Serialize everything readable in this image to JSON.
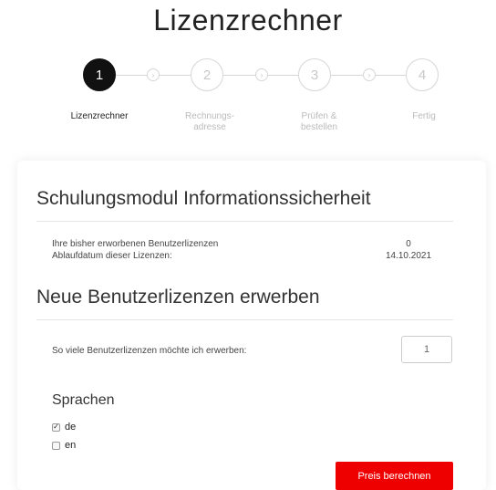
{
  "page_title": "Lizenzrechner",
  "steps": [
    {
      "number": "1",
      "label": "Lizenzrechner",
      "active": true
    },
    {
      "number": "2",
      "label": "Rechnungs-\nadresse",
      "active": false
    },
    {
      "number": "3",
      "label": "Prüfen &\nbestellen",
      "active": false
    },
    {
      "number": "4",
      "label": "Fertig",
      "active": false
    }
  ],
  "step_separator_icon": "chevron-right-icon",
  "module": {
    "title": "Schulungsmodul Informationssicherheit",
    "licenses_label": "Ihre bisher erworbenen Benutzerlizenzen",
    "licenses_value": "0",
    "expiry_label": "Ablaufdatum dieser Lizenzen:",
    "expiry_value": "14.10.2021"
  },
  "new_licenses": {
    "title": "Neue Benutzerlizenzen erwerben",
    "quantity_label": "So viele Benutzerlizenzen möchte ich erwerben:",
    "quantity_value": "1"
  },
  "languages": {
    "title": "Sprachen",
    "options": [
      {
        "label": "de",
        "checked": true
      },
      {
        "label": "en",
        "checked": false
      }
    ]
  },
  "calculate_button": "Preis berechnen",
  "colors": {
    "accent": "#ee0000",
    "active_step": "#111111"
  }
}
